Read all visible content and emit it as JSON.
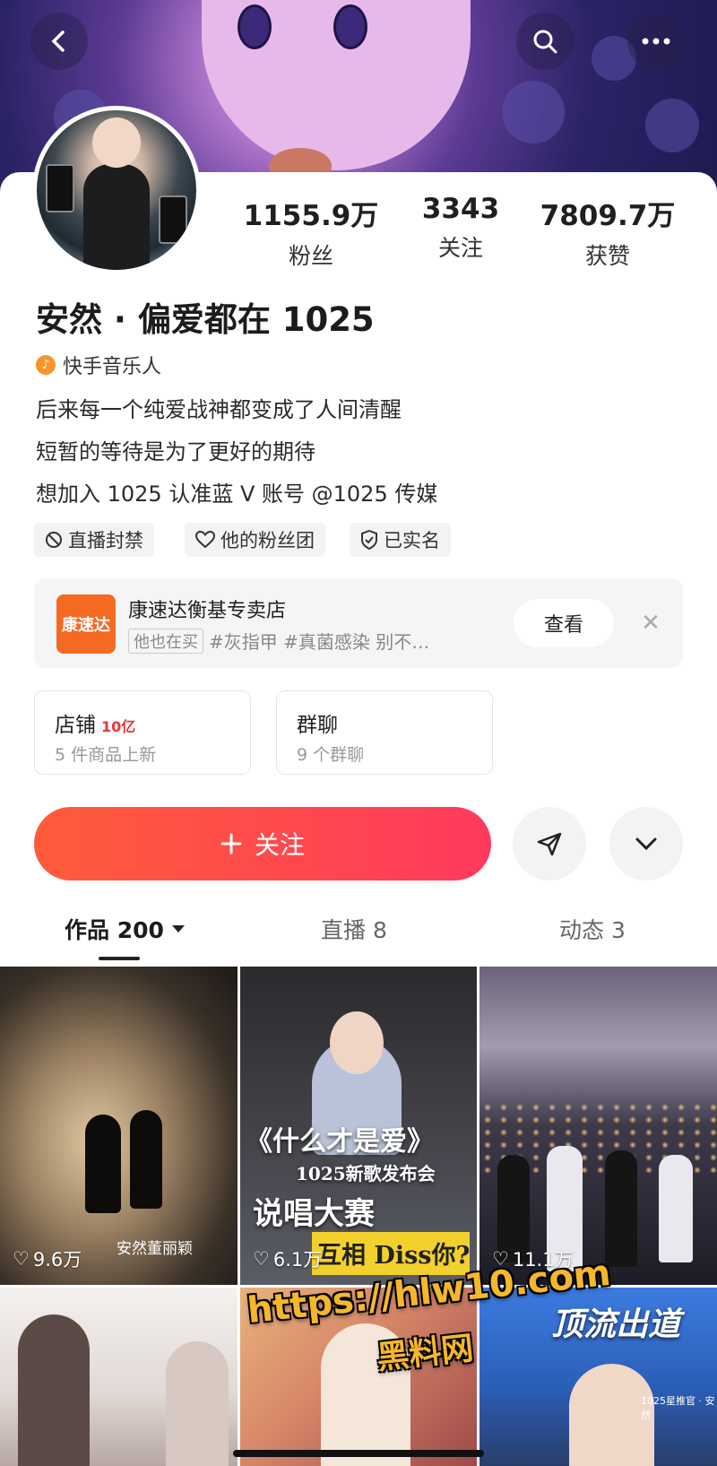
{
  "stats": [
    {
      "value": "1155.9万",
      "label": "粉丝"
    },
    {
      "value": "3343",
      "label": "关注"
    },
    {
      "value": "7809.7万",
      "label": "获赞"
    }
  ],
  "profile": {
    "name": "安然 · 偏爱都在 1025",
    "role": "快手音乐人",
    "bio": [
      "后来每一个纯爱战神都变成了人间清醒",
      "短暂的等待是为了更好的期待",
      "想加入 1025 认准蓝 V 账号 @1025 传媒"
    ]
  },
  "chips": [
    "直播封禁",
    "他的粉丝团",
    "已实名"
  ],
  "shop_ad": {
    "logo_text": "康速达",
    "title": "康速达衡基专卖店",
    "tag": "他也在买",
    "subtitle": "#灰指甲 #真菌感染 别不…",
    "view_label": "查看"
  },
  "cards": [
    {
      "title": "店铺",
      "badge": "10亿",
      "sub": "5 件商品上新"
    },
    {
      "title": "群聊",
      "badge": "",
      "sub": "9 个群聊"
    }
  ],
  "follow_label": "关注",
  "tabs": [
    {
      "label": "作品 200"
    },
    {
      "label": "直播 8"
    },
    {
      "label": "动态 3"
    }
  ],
  "videos": [
    {
      "likes": "9.6万",
      "caption": "安然董丽颖"
    },
    {
      "likes": "6.1万",
      "title": "《什么才是爱》",
      "sub": "1025新歌发布会",
      "big": "说唱大赛",
      "tagline": "互相 Diss你?"
    },
    {
      "likes": "11.1万"
    },
    {},
    {},
    {
      "text1": "顶流出道",
      "small": "1025星推官 · 安然"
    }
  ],
  "watermark": {
    "line1": "https://hlw10.com",
    "line2": "黑料网"
  },
  "colors": {
    "accent": "#ff4a4a",
    "follow_start": "#ff5b3a",
    "follow_end": "#ff3a5d"
  }
}
